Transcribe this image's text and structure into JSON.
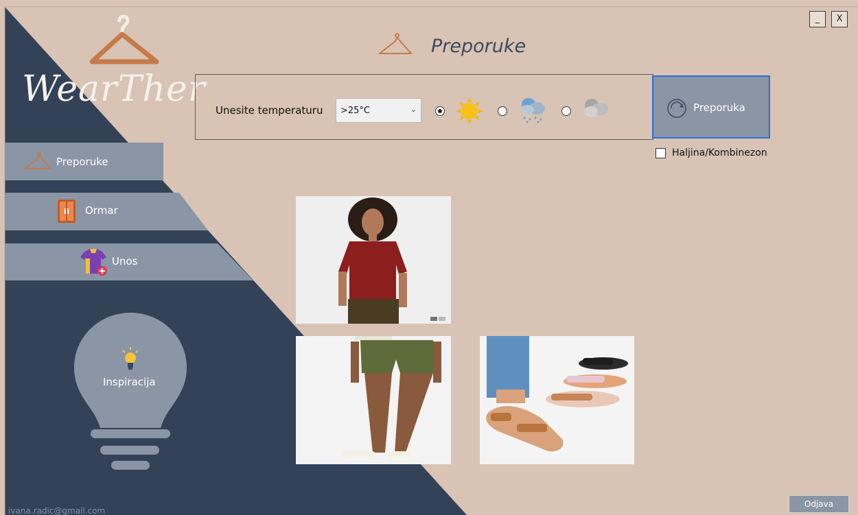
{
  "window": {
    "minimize_label": "_",
    "close_label": "X"
  },
  "app": {
    "logo_text": "WearTher"
  },
  "header": {
    "title": "Preporuke"
  },
  "sidebar": {
    "items": [
      {
        "label": "Preporuke",
        "icon": "hanger-icon"
      },
      {
        "label": "Ormar",
        "icon": "wardrobe-icon"
      },
      {
        "label": "Unos",
        "icon": "add-clothes-icon"
      }
    ],
    "inspiration_label": "Inspiracija",
    "user_email": "ivana.radic@gmail.com"
  },
  "filters": {
    "temperature_label": "Unesite temperaturu",
    "temperature_value": ">25°C",
    "weather_options": [
      {
        "icon": "sun-icon",
        "selected": true
      },
      {
        "icon": "rain-cloud-icon",
        "selected": false
      },
      {
        "icon": "cloud-icon",
        "selected": false
      }
    ],
    "recommend_button": "Preporuka",
    "dress_checkbox_label": "Haljina/Kombinezon",
    "dress_checked": false
  },
  "results": {
    "items": [
      {
        "icon": "photo-red-tshirt"
      },
      {
        "icon": "photo-green-shorts"
      },
      {
        "icon": "photo-tan-sandals"
      }
    ]
  },
  "footer": {
    "logout_label": "Odjava"
  },
  "colors": {
    "beige": "#d8c3b4",
    "navy": "#344258",
    "slate": "#8a95a5",
    "accent_brown": "#c67a4b"
  }
}
